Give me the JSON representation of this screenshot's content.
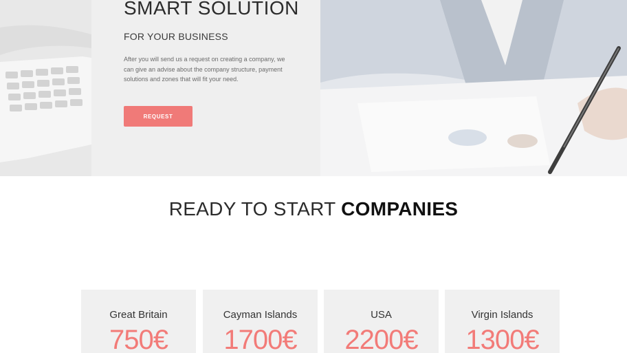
{
  "hero": {
    "title": "SMART SOLUTION",
    "subtitle": "FOR YOUR BUSINESS",
    "description": "After you will send us a request on creating a company, we can give an advise about the company structure, payment solutions and zones that will fit your need.",
    "button_label": "REQUEST",
    "background_image": "office-desk-laptop-pen-photo"
  },
  "section": {
    "heading_light": "READY TO START",
    "heading_bold": "COMPANIES"
  },
  "companies": [
    {
      "name": "Great Britain",
      "price": "750€"
    },
    {
      "name": "Cayman Islands",
      "price": "1700€"
    },
    {
      "name": "USA",
      "price": "2200€"
    },
    {
      "name": "Virgin Islands",
      "price": "1300€"
    }
  ],
  "colors": {
    "accent": "#f07a78",
    "card_bg": "#f0f0f0",
    "heading": "#111111"
  }
}
